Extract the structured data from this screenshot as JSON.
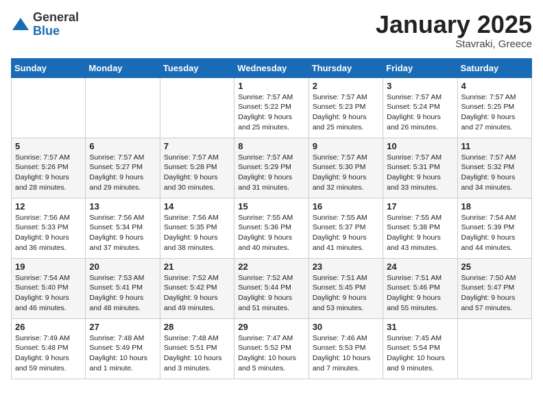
{
  "header": {
    "logo_general": "General",
    "logo_blue": "Blue",
    "month_title": "January 2025",
    "subtitle": "Stavraki, Greece"
  },
  "weekdays": [
    "Sunday",
    "Monday",
    "Tuesday",
    "Wednesday",
    "Thursday",
    "Friday",
    "Saturday"
  ],
  "weeks": [
    [
      {
        "day": "",
        "text": ""
      },
      {
        "day": "",
        "text": ""
      },
      {
        "day": "",
        "text": ""
      },
      {
        "day": "1",
        "text": "Sunrise: 7:57 AM\nSunset: 5:22 PM\nDaylight: 9 hours\nand 25 minutes."
      },
      {
        "day": "2",
        "text": "Sunrise: 7:57 AM\nSunset: 5:23 PM\nDaylight: 9 hours\nand 25 minutes."
      },
      {
        "day": "3",
        "text": "Sunrise: 7:57 AM\nSunset: 5:24 PM\nDaylight: 9 hours\nand 26 minutes."
      },
      {
        "day": "4",
        "text": "Sunrise: 7:57 AM\nSunset: 5:25 PM\nDaylight: 9 hours\nand 27 minutes."
      }
    ],
    [
      {
        "day": "5",
        "text": "Sunrise: 7:57 AM\nSunset: 5:26 PM\nDaylight: 9 hours\nand 28 minutes."
      },
      {
        "day": "6",
        "text": "Sunrise: 7:57 AM\nSunset: 5:27 PM\nDaylight: 9 hours\nand 29 minutes."
      },
      {
        "day": "7",
        "text": "Sunrise: 7:57 AM\nSunset: 5:28 PM\nDaylight: 9 hours\nand 30 minutes."
      },
      {
        "day": "8",
        "text": "Sunrise: 7:57 AM\nSunset: 5:29 PM\nDaylight: 9 hours\nand 31 minutes."
      },
      {
        "day": "9",
        "text": "Sunrise: 7:57 AM\nSunset: 5:30 PM\nDaylight: 9 hours\nand 32 minutes."
      },
      {
        "day": "10",
        "text": "Sunrise: 7:57 AM\nSunset: 5:31 PM\nDaylight: 9 hours\nand 33 minutes."
      },
      {
        "day": "11",
        "text": "Sunrise: 7:57 AM\nSunset: 5:32 PM\nDaylight: 9 hours\nand 34 minutes."
      }
    ],
    [
      {
        "day": "12",
        "text": "Sunrise: 7:56 AM\nSunset: 5:33 PM\nDaylight: 9 hours\nand 36 minutes."
      },
      {
        "day": "13",
        "text": "Sunrise: 7:56 AM\nSunset: 5:34 PM\nDaylight: 9 hours\nand 37 minutes."
      },
      {
        "day": "14",
        "text": "Sunrise: 7:56 AM\nSunset: 5:35 PM\nDaylight: 9 hours\nand 38 minutes."
      },
      {
        "day": "15",
        "text": "Sunrise: 7:55 AM\nSunset: 5:36 PM\nDaylight: 9 hours\nand 40 minutes."
      },
      {
        "day": "16",
        "text": "Sunrise: 7:55 AM\nSunset: 5:37 PM\nDaylight: 9 hours\nand 41 minutes."
      },
      {
        "day": "17",
        "text": "Sunrise: 7:55 AM\nSunset: 5:38 PM\nDaylight: 9 hours\nand 43 minutes."
      },
      {
        "day": "18",
        "text": "Sunrise: 7:54 AM\nSunset: 5:39 PM\nDaylight: 9 hours\nand 44 minutes."
      }
    ],
    [
      {
        "day": "19",
        "text": "Sunrise: 7:54 AM\nSunset: 5:40 PM\nDaylight: 9 hours\nand 46 minutes."
      },
      {
        "day": "20",
        "text": "Sunrise: 7:53 AM\nSunset: 5:41 PM\nDaylight: 9 hours\nand 48 minutes."
      },
      {
        "day": "21",
        "text": "Sunrise: 7:52 AM\nSunset: 5:42 PM\nDaylight: 9 hours\nand 49 minutes."
      },
      {
        "day": "22",
        "text": "Sunrise: 7:52 AM\nSunset: 5:44 PM\nDaylight: 9 hours\nand 51 minutes."
      },
      {
        "day": "23",
        "text": "Sunrise: 7:51 AM\nSunset: 5:45 PM\nDaylight: 9 hours\nand 53 minutes."
      },
      {
        "day": "24",
        "text": "Sunrise: 7:51 AM\nSunset: 5:46 PM\nDaylight: 9 hours\nand 55 minutes."
      },
      {
        "day": "25",
        "text": "Sunrise: 7:50 AM\nSunset: 5:47 PM\nDaylight: 9 hours\nand 57 minutes."
      }
    ],
    [
      {
        "day": "26",
        "text": "Sunrise: 7:49 AM\nSunset: 5:48 PM\nDaylight: 9 hours\nand 59 minutes."
      },
      {
        "day": "27",
        "text": "Sunrise: 7:48 AM\nSunset: 5:49 PM\nDaylight: 10 hours\nand 1 minute."
      },
      {
        "day": "28",
        "text": "Sunrise: 7:48 AM\nSunset: 5:51 PM\nDaylight: 10 hours\nand 3 minutes."
      },
      {
        "day": "29",
        "text": "Sunrise: 7:47 AM\nSunset: 5:52 PM\nDaylight: 10 hours\nand 5 minutes."
      },
      {
        "day": "30",
        "text": "Sunrise: 7:46 AM\nSunset: 5:53 PM\nDaylight: 10 hours\nand 7 minutes."
      },
      {
        "day": "31",
        "text": "Sunrise: 7:45 AM\nSunset: 5:54 PM\nDaylight: 10 hours\nand 9 minutes."
      },
      {
        "day": "",
        "text": ""
      }
    ]
  ]
}
